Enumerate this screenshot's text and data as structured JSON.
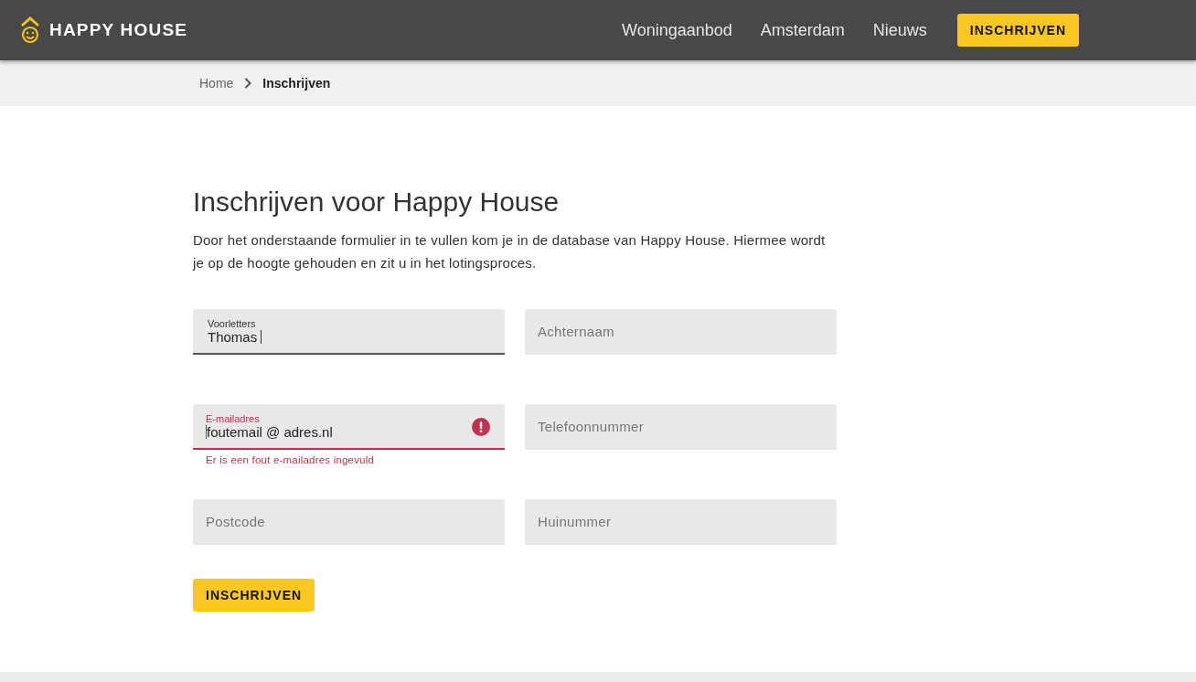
{
  "header": {
    "logo": "HAPPY HOUSE",
    "nav": [
      {
        "label": "Woningaanbod"
      },
      {
        "label": "Amsterdam"
      },
      {
        "label": "Nieuws"
      }
    ],
    "cta": "INSCHRIJVEN"
  },
  "breadcrumb": [
    {
      "label": "Home",
      "current": false
    },
    {
      "label": "Inschrijven",
      "current": true
    }
  ],
  "title": "Inschrijven voor Happy House",
  "intro": "Door het onderstaande formulier in te vullen kom je in de database van Happy House. Hiermee wordt je op de hoogte gehouden en zit u in het lotingsproces.",
  "fields": [
    {
      "label": "Voorletters",
      "value": "Thomas",
      "focused": true,
      "error": false
    },
    {
      "placeholder": "Achternaam",
      "focused": false,
      "error": false
    },
    {
      "label": "E-mailadres",
      "value": "foutemail @ adres.nl",
      "focused": false,
      "error": true,
      "error_message": "Er is een fout e-mailadres ingevuld"
    },
    {
      "placeholder": "Telefoonnummer",
      "focused": false,
      "error": false
    },
    {
      "placeholder": "Postcode",
      "focused": false,
      "error": false
    },
    {
      "placeholder": "Huinummer",
      "focused": false,
      "error": false
    }
  ],
  "submit": "INSCHRIJVEN"
}
